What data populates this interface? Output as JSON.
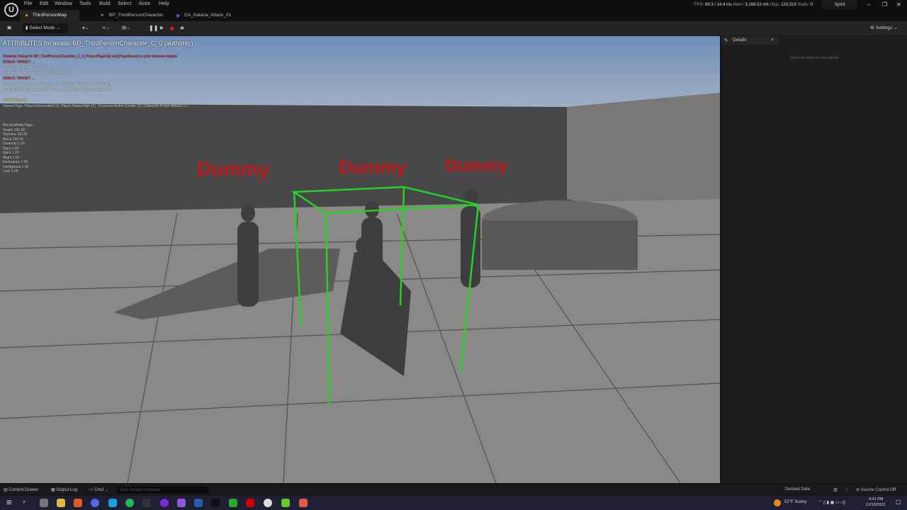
{
  "menu": [
    "File",
    "Edit",
    "Window",
    "Tools",
    "Build",
    "Select",
    "Actor",
    "Help"
  ],
  "tabs": [
    {
      "label": "ThirdPersonMap"
    },
    {
      "label": "BP_ThirdPersonCharacter"
    },
    {
      "label": "GA_Katana_Attack_01"
    }
  ],
  "stats": {
    "fps_label": "FPS:",
    "fps": "69.3",
    "ms": "/ 14.4 ms",
    "mem_label": "Mem:",
    "mem": "3,168.53 mb",
    "objs_label": "Objs:",
    "objs": "133,319",
    "stalls_label": "Stalls:",
    "stalls": "0"
  },
  "project": "Spirit",
  "toolbar": {
    "select_mode": "Select Mode",
    "settings": "Settings"
  },
  "details": {
    "tab": "Details",
    "hint": "Select an object to view details"
  },
  "debug": {
    "header": "ATTRIBUTES for avatar BP_ThirdPersonCharacter_C_0 (authority)",
    "lines": [
      {
        "text": "Showing Debug for BP_ThirdPersonCharacter_C_0, Press [PageUp] and [PageDown] to cycle between targets",
        "cls": "red"
      },
      {
        "text": "DEBUG TARGET: ...",
        "cls": "red"
      },
      {
        "text": "Location: (0) Rotation: R(0)",
        "cls": ""
      },
      {
        "text": "Instigator: None Owner: PlayerController_0",
        "cls": ""
      },
      {
        "text": "DEBUG TARGET: ...",
        "cls": "red"
      },
      {
        "text": "Location: X=-1,623.17, Y=-1,031.76, Z=92.01] Rotation: R(Y=-66.85)",
        "cls": ""
      },
      {
        "text": "Instigator: BP_ThirdPersonCharacter_C_0 Owner: PlayerController_0",
        "cls": ""
      },
      {
        "text": "",
        "cls": "red"
      },
      {
        "text": "STATE Playing",
        "cls": "yel"
      },
      {
        "text": "Owned Tags: Player.IsGrounded (1), Player.Status.High (2), Character.Action.Combo (1), Character.Action.Attack3 (1)",
        "cls": ""
      }
    ],
    "attributes": [
      "BlockedAbilityTags:",
      "Health 100.00",
      "Stamina 100.00",
      "Mana 100.00",
      "Dexterity 1.00",
      "Vigor 1.00",
      "Spirit 1.00",
      "Might 1.00",
      "Endurance 1.00",
      "Intelligence 1.00",
      "Luck 1.00"
    ]
  },
  "dummy_label": "Dummy",
  "bottom": {
    "content_drawer": "Content Drawer",
    "output_log": "Output Log",
    "cmd": "Cmd",
    "console_placeholder": "Enter Console Command",
    "derived_data": "Derived Data",
    "source_control": "Source Control Off"
  },
  "tray": {
    "weather": "52°F  Sunny",
    "time": "4:41 PM",
    "date": "12/15/2022"
  },
  "colors": {
    "accent_green": "#22d422",
    "dummy_red": "#c01818"
  }
}
